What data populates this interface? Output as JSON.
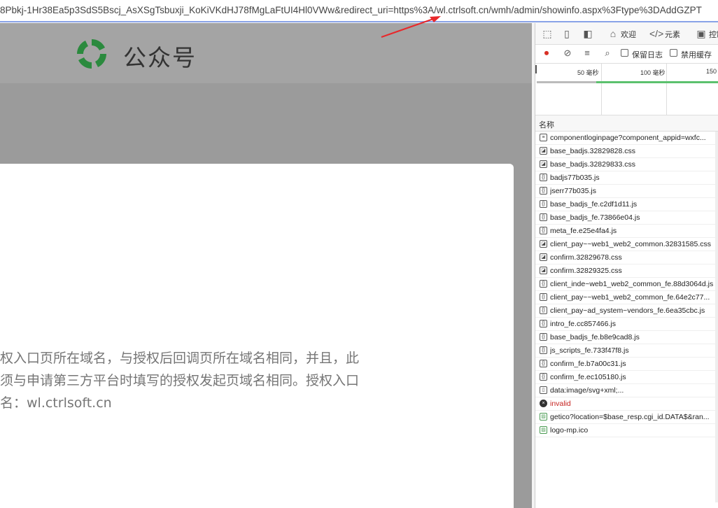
{
  "urlbar": {
    "url": "8Pbkj-1Hr38Ea5p3SdS5Bscj_AsXSgTsbuxji_KoKiVKdHJ78fMgLaFtUI4Hl0VWw&redirect_uri=https%3A/wl.ctrlsoft.cn/wmh/admin/showinfo.aspx%3Ftype%3DAddGZPT"
  },
  "page": {
    "logo_text": "公众号",
    "message_lines": [
      "权入口页所在域名，与授权后回调页所在域名相同，并且，此",
      "须与申请第三方平台时填写的授权发起页域名相同。授权入口",
      "名：wl.ctrlsoft.cn"
    ]
  },
  "devtools": {
    "tabs": {
      "welcome": "欢迎",
      "elements": "元素",
      "console": "控制"
    },
    "toolbar": {
      "preserve_log": "保留日志",
      "disable_cache": "禁用缓存"
    },
    "timeline": {
      "ticks": [
        "50 毫秒",
        "100 毫秒",
        "150"
      ]
    },
    "column_name": "名称",
    "requests": [
      {
        "name": "componentloginpage?component_appid=wxfc...",
        "type": "doc"
      },
      {
        "name": "base_badjs.32829828.css",
        "type": "css"
      },
      {
        "name": "base_badjs.32829833.css",
        "type": "css"
      },
      {
        "name": "badjs77b035.js",
        "type": "js"
      },
      {
        "name": "jserr77b035.js",
        "type": "js"
      },
      {
        "name": "base_badjs_fe.c2df1d11.js",
        "type": "js"
      },
      {
        "name": "base_badjs_fe.73866e04.js",
        "type": "js"
      },
      {
        "name": "meta_fe.e25e4fa4.js",
        "type": "js"
      },
      {
        "name": "client_pay~~web1_web2_common.32831585.css",
        "type": "css"
      },
      {
        "name": "confirm.32829678.css",
        "type": "css"
      },
      {
        "name": "confirm.32829325.css",
        "type": "css"
      },
      {
        "name": "client_inde~web1_web2_common_fe.88d3064d.js",
        "type": "js"
      },
      {
        "name": "client_pay~~web1_web2_common_fe.64e2c77...",
        "type": "js"
      },
      {
        "name": "client_pay~ad_system~vendors_fe.6ea35cbc.js",
        "type": "js"
      },
      {
        "name": "intro_fe.cc857466.js",
        "type": "js"
      },
      {
        "name": "base_badjs_fe.b8e9cad8.js",
        "type": "js"
      },
      {
        "name": "js_scripts_fe.733f47f8.js",
        "type": "js"
      },
      {
        "name": "confirm_fe.b7a00c31.js",
        "type": "js"
      },
      {
        "name": "confirm_fe.ec105180.js",
        "type": "js"
      },
      {
        "name": "data:image/svg+xml;...",
        "type": "file"
      },
      {
        "name": "invalid",
        "type": "error"
      },
      {
        "name": "getico?location=$base_resp.cgi_id.DATA$&ran...",
        "type": "img"
      },
      {
        "name": "logo-mp.ico",
        "type": "img"
      }
    ]
  }
}
